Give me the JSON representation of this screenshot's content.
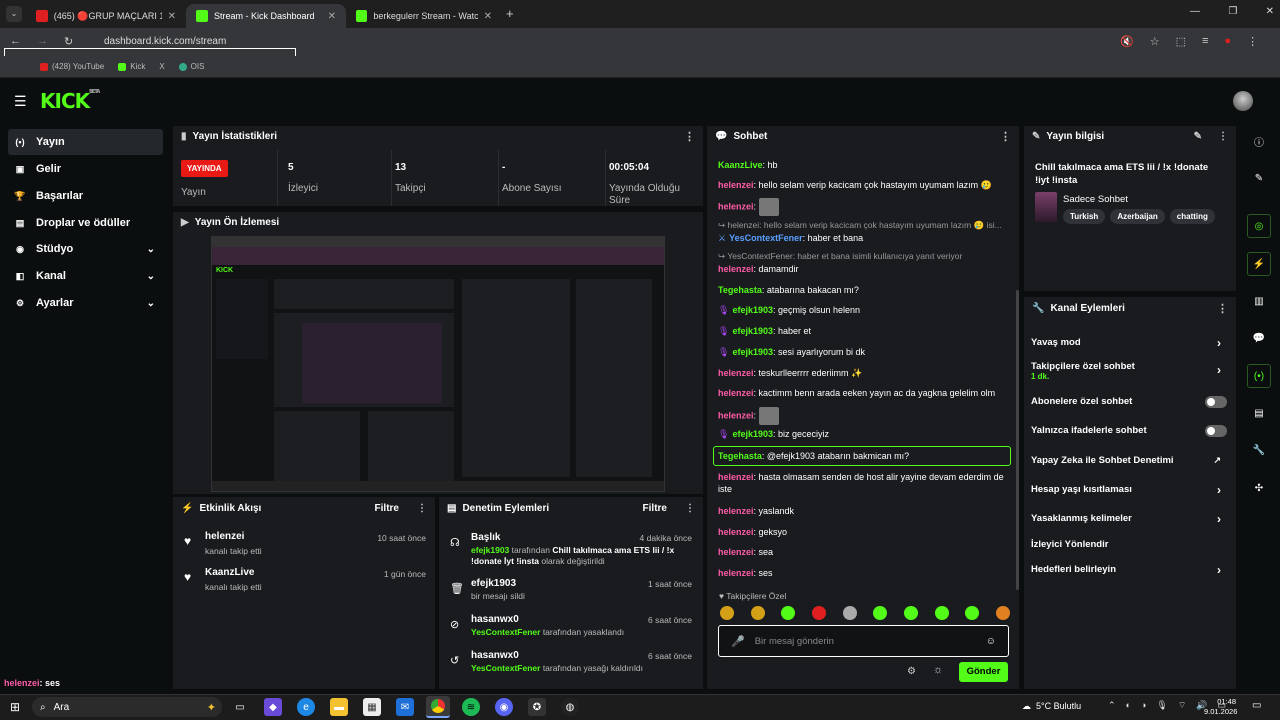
{
  "browser": {
    "tabs": [
      {
        "label": "(465) 🔴GRUP MAÇLARI 1.GÜN",
        "color": "#e02020"
      },
      {
        "label": "Stream - Kick Dashboard",
        "color": "#53fc18"
      },
      {
        "label": "berkegulerr Stream - Watch Li",
        "color": "#53fc18"
      }
    ],
    "url": "dashboard.kick.com/stream",
    "bookmarks": [
      "(428) YouTube",
      "Kick",
      "X",
      "OIS"
    ]
  },
  "kick": {
    "logo": "KICK",
    "logo_sup": "BETA"
  },
  "sidebar": {
    "items": [
      {
        "label": "Yayın",
        "icon": "broadcast-icon",
        "glyph": "(•)"
      },
      {
        "label": "Gelir",
        "icon": "money-icon",
        "glyph": "▣"
      },
      {
        "label": "Başarılar",
        "icon": "trophy-icon",
        "glyph": "🏆"
      },
      {
        "label": "Droplar ve ödüller",
        "icon": "gift-icon",
        "glyph": "▤"
      },
      {
        "label": "Stüdyo",
        "icon": "studio-icon",
        "glyph": "◉"
      },
      {
        "label": "Kanal",
        "icon": "channel-icon",
        "glyph": "◧"
      },
      {
        "label": "Ayarlar",
        "icon": "gear-icon",
        "glyph": "⚙"
      }
    ]
  },
  "stats": {
    "title": "Yayın İstatistikleri",
    "live_badge": "YAYINDA",
    "live_label": "Yayın",
    "items": [
      {
        "value": "5",
        "label": "İzleyici"
      },
      {
        "value": "13",
        "label": "Takipçi"
      },
      {
        "value": "-",
        "label": "Abone Sayısı"
      },
      {
        "value": "00:05:04",
        "label": "Yayında Olduğu Süre"
      }
    ]
  },
  "preview": {
    "title": "Yayın Ön İzlemesi"
  },
  "activity": {
    "title": "Etkinlik Akışı",
    "filter": "Filtre",
    "items": [
      {
        "user": "helenzei",
        "desc": "kanalı takip etti",
        "time": "10 saat önce"
      },
      {
        "user": "KaanzLive",
        "desc": "kanalı takip etti",
        "time": "1 gün önce"
      }
    ]
  },
  "moderation": {
    "title": "Denetim Eylemleri",
    "filter": "Filtre",
    "items": [
      {
        "title": "Başlık",
        "time": "4 dakika önce",
        "actor": "efejk1903",
        "mid": " tarafından ",
        "target": "Chill takılmaca ama ETS lii / !x !donate İyt !insta",
        "tail": " olarak değiştirildi"
      },
      {
        "title": "efejk1903",
        "time": "1 saat önce",
        "actor": "",
        "mid": "bir mesajı sildi",
        "target": "",
        "tail": ""
      },
      {
        "title": "hasanwx0",
        "time": "6 saat önce",
        "actor": "YesContextFener",
        "mid": " tarafından yasaklandı",
        "target": "",
        "tail": ""
      },
      {
        "title": "hasanwx0",
        "time": "6 saat önce",
        "actor": "YesContextFener",
        "mid": " tarafından yasağı kaldırıldı",
        "target": "",
        "tail": ""
      }
    ]
  },
  "chat": {
    "title": "Sohbet",
    "messages": [
      {
        "user": "KaanzLive",
        "color": "#53fc18",
        "text": "hb"
      },
      {
        "user": "helenzei",
        "color": "#ff5ca8",
        "text": "hello selam verip kacicam çok hastayım uyumam lazım 🥲"
      },
      {
        "user": "helenzei",
        "color": "#ff5ca8",
        "text": "[sticker]"
      },
      {
        "user": "",
        "color": "#999",
        "text": "↪ helenzei: hello selam verip kacicam çok hastayım uyumam lazım 🥲 isi..."
      },
      {
        "user": "YesContextFener",
        "color": "#5aa0ff",
        "text": "haber et bana"
      },
      {
        "user": "",
        "color": "#999",
        "text": "↪ YesContextFener: haber et bana isimli kullanıcıya yanıt veriyor"
      },
      {
        "user": "helenzei",
        "color": "#ff5ca8",
        "text": "damamdir"
      },
      {
        "user": "Tegehasta",
        "color": "#53fc18",
        "text": "atabarına bakacan mı?"
      },
      {
        "user": "efejk1903",
        "color": "#53fc18",
        "text": "geçmiş olsun helenn"
      },
      {
        "user": "efejk1903",
        "color": "#53fc18",
        "text": "haber et"
      },
      {
        "user": "efejk1903",
        "color": "#53fc18",
        "text": "sesi ayarlıyorum bi dk"
      },
      {
        "user": "helenzei",
        "color": "#ff5ca8",
        "text": "teskurlleerrrr ederiimm ✨"
      },
      {
        "user": "helenzei",
        "color": "#ff5ca8",
        "text": "kactimm benn arada eeken yayın ac da yagkna gelelim olm"
      },
      {
        "user": "helenzei",
        "color": "#ff5ca8",
        "text": "[sticker]"
      },
      {
        "user": "efejk1903",
        "color": "#53fc18",
        "text": "biz gececiyiz"
      },
      {
        "user": "Tegehasta",
        "color": "#53fc18",
        "text": "@efejk1903 atabarın bakmican mı?"
      },
      {
        "user": "helenzei",
        "color": "#ff5ca8",
        "text": "hasta olmasam senden de host alir yayine devam ederdim de iste"
      },
      {
        "user": "helenzei",
        "color": "#ff5ca8",
        "text": "yaslandk"
      },
      {
        "user": "helenzei",
        "color": "#ff5ca8",
        "text": "geksyo"
      },
      {
        "user": "helenzei",
        "color": "#ff5ca8",
        "text": "sea"
      },
      {
        "user": "helenzei",
        "color": "#ff5ca8",
        "text": "ses"
      }
    ],
    "followers_only": "Takipçilere Özel",
    "placeholder": "Bir mesaj gönderin",
    "send": "Gönder"
  },
  "info": {
    "title": "Yayın bilgisi",
    "stream_title": "Chill takılmaca ama ETS lii / !x !donate !iyt !insta",
    "category": "Sadece Sohbet",
    "tags": [
      "Turkish",
      "Azerbaijan",
      "chatting"
    ]
  },
  "channel_actions": {
    "title": "Kanal Eylemleri",
    "rows": [
      {
        "label": "Yavaş mod",
        "sub": "",
        "ctrl": "chevron"
      },
      {
        "label": "Takipçilere özel sohbet",
        "sub": "1 dk.",
        "ctrl": "chevron"
      },
      {
        "label": "Abonelere özel sohbet",
        "sub": "",
        "ctrl": "toggle"
      },
      {
        "label": "Yalnızca ifadelerle sohbet",
        "sub": "",
        "ctrl": "toggle"
      },
      {
        "label": "Yapay Zeka ile Sohbet Denetimi",
        "sub": "",
        "ctrl": "external"
      },
      {
        "label": "Hesap yaşı kısıtlaması",
        "sub": "",
        "ctrl": "chevron"
      },
      {
        "label": "Yasaklanmış kelimeler",
        "sub": "",
        "ctrl": "chevron"
      },
      {
        "label": "İzleyici Yönlendir",
        "sub": "",
        "ctrl": "none"
      },
      {
        "label": "Hedefleri belirleyin",
        "sub": "",
        "ctrl": "chevron"
      }
    ]
  },
  "overlay_text": {
    "user": "helenzei",
    "text": ": ses"
  },
  "taskbar": {
    "search": "Ara",
    "weather": "5°C  Bulutlu",
    "time": "01:48",
    "date": "9.01.2026"
  }
}
